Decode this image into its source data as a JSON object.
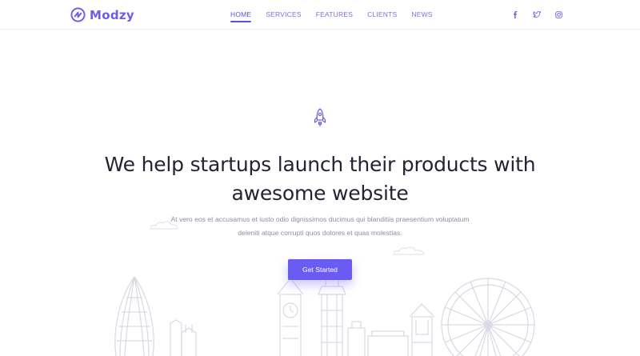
{
  "brand": {
    "name": "Modzy",
    "icon": "logo-mark-icon",
    "color": "#6c5ce7"
  },
  "nav": {
    "items": [
      {
        "label": "HOME",
        "active": true
      },
      {
        "label": "SERVICES",
        "active": false
      },
      {
        "label": "FEATURES",
        "active": false
      },
      {
        "label": "CLIENTS",
        "active": false
      },
      {
        "label": "NEWS",
        "active": false
      }
    ],
    "social": [
      {
        "icon": "facebook-icon"
      },
      {
        "icon": "twitter-icon"
      },
      {
        "icon": "instagram-icon"
      }
    ]
  },
  "hero": {
    "icon": "rocket-icon",
    "headline": "We help startups launch their products with awesome website",
    "subtext_line1": "At vero eos et accusamus et iusto odio dignissimos ducimus qui blanditiis praesentium voluptatum",
    "subtext_line2": "deleniti atque corrupti quos dolores et quas molestias.",
    "cta_label": "Get Started",
    "background": "city-skyline-illustration"
  },
  "colors": {
    "accent": "#6a5cf2",
    "text": "#232334",
    "muted": "#8d8ea3"
  }
}
